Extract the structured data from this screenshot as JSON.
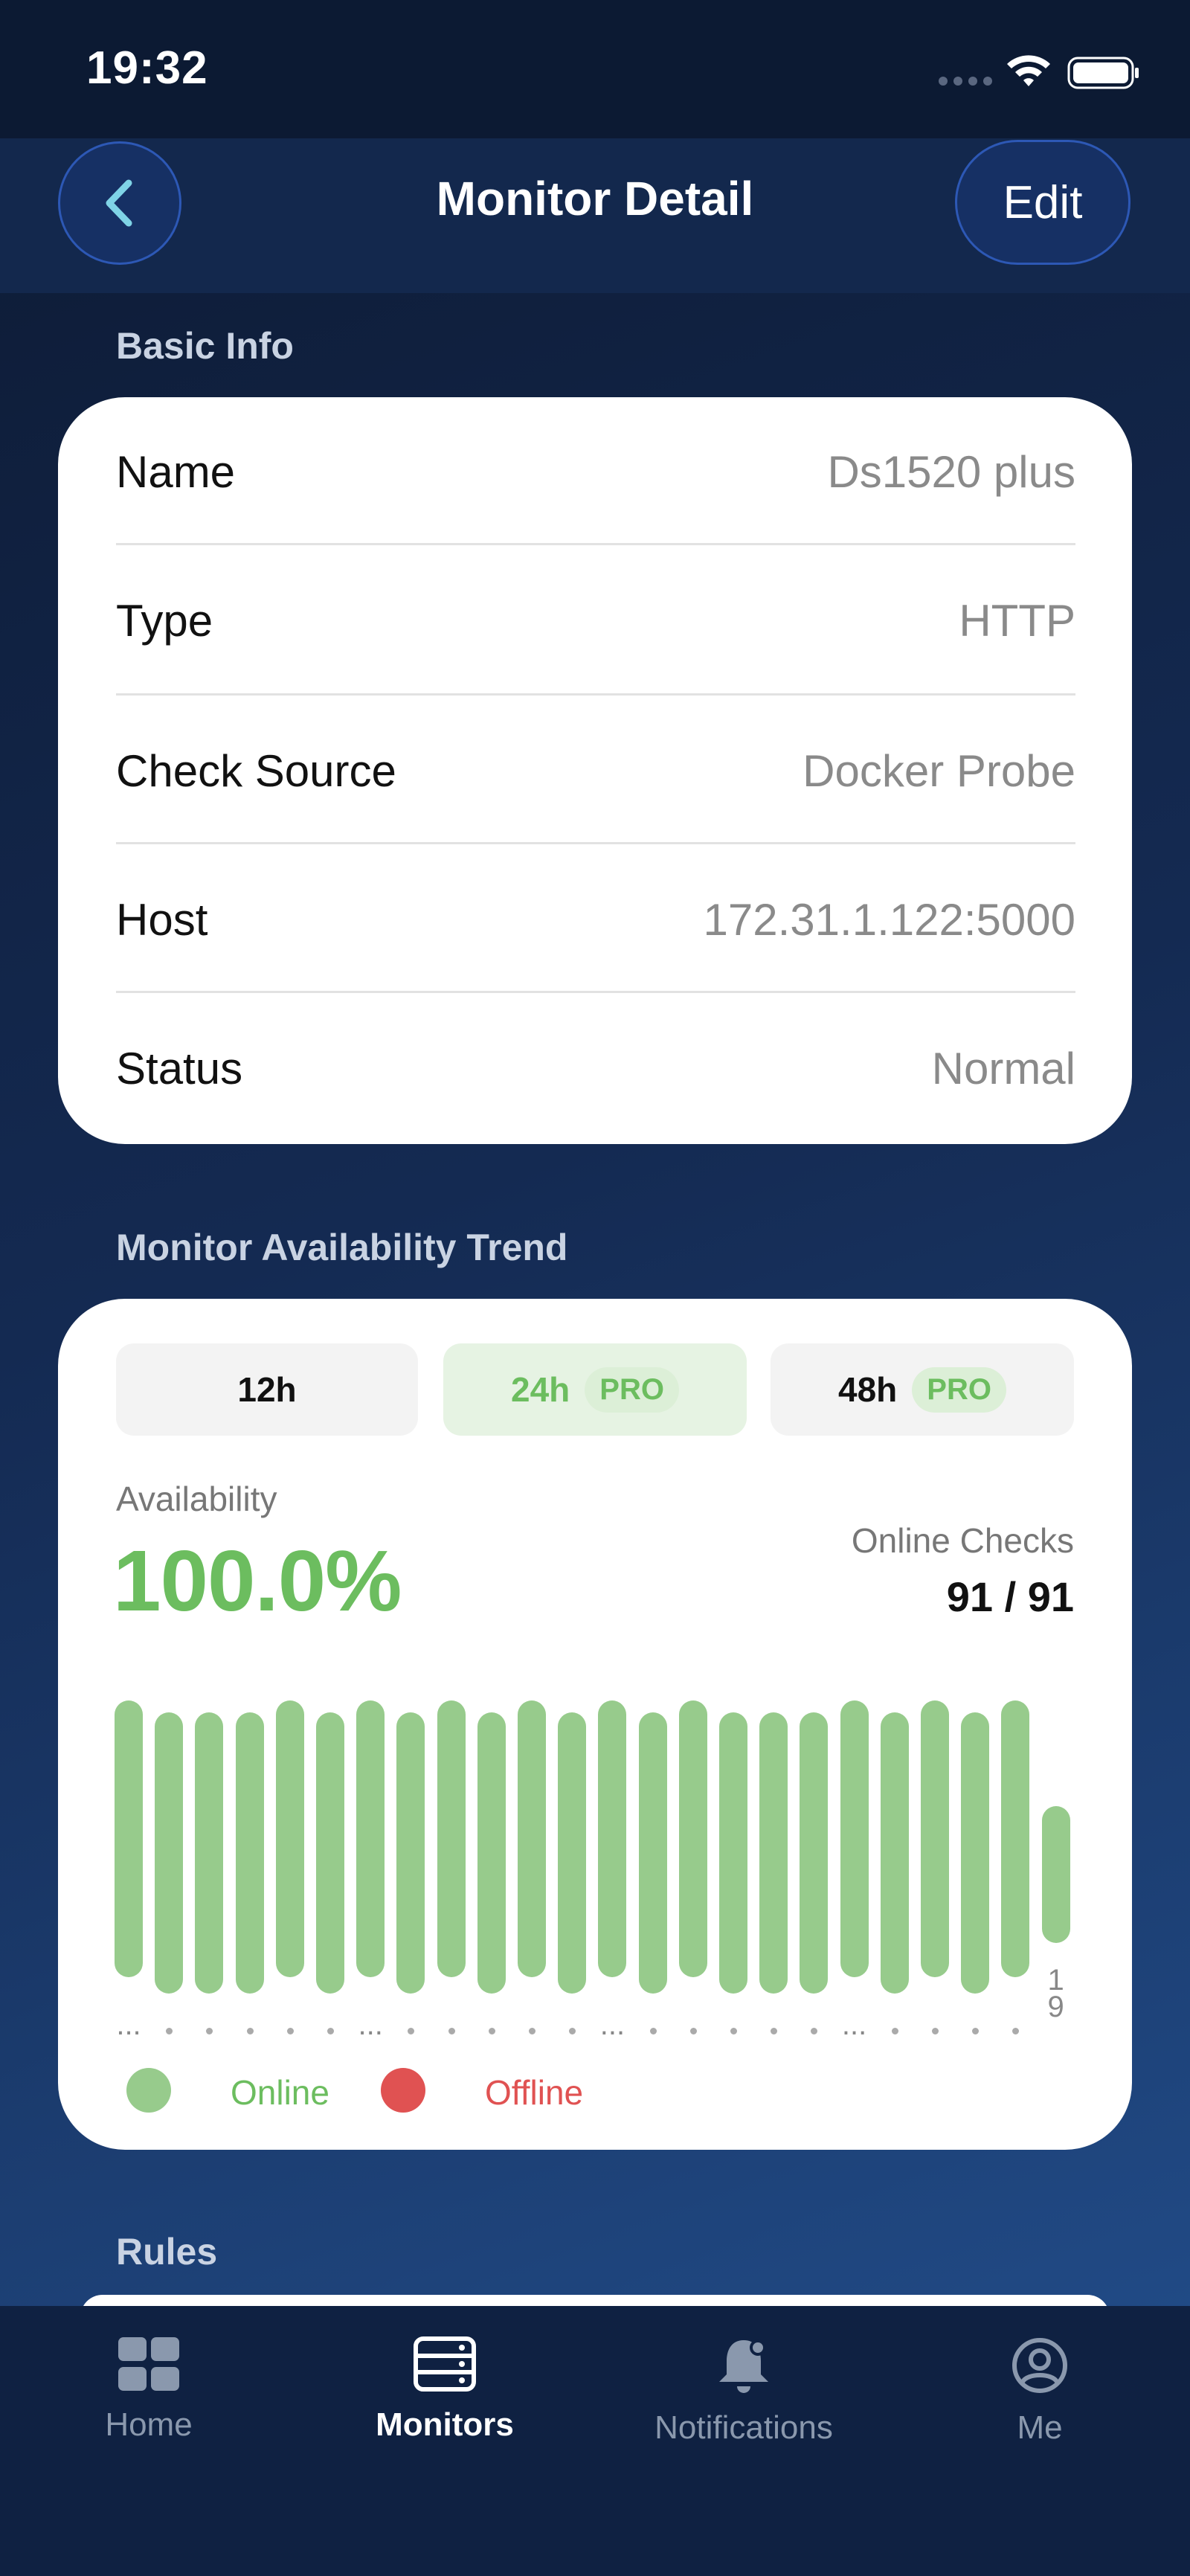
{
  "status_bar": {
    "time": "19:32"
  },
  "nav": {
    "title": "Monitor Detail",
    "edit_label": "Edit"
  },
  "basic_info": {
    "section_title": "Basic Info",
    "rows": [
      {
        "label": "Name",
        "value": "Ds1520 plus"
      },
      {
        "label": "Type",
        "value": "HTTP"
      },
      {
        "label": "Check Source",
        "value": "Docker Probe"
      },
      {
        "label": "Host",
        "value": "172.31.1.122:5000"
      },
      {
        "label": "Status",
        "value": "Normal"
      }
    ]
  },
  "trend": {
    "section_title": "Monitor Availability Trend",
    "ranges": [
      {
        "label": "12h",
        "pro": "",
        "active": false
      },
      {
        "label": "24h",
        "pro": "PRO",
        "active": true
      },
      {
        "label": "48h",
        "pro": "PRO",
        "active": false
      }
    ],
    "availability_label": "Availability",
    "availability_value": "100.0%",
    "online_checks_label": "Online Checks",
    "online_checks_value": "91 / 91",
    "legend": {
      "online": "Online",
      "offline": "Offline"
    },
    "colors": {
      "online": "#97cb8c",
      "offline": "#e05252",
      "accent": "#6cbd5f"
    }
  },
  "chart_data": {
    "type": "bar",
    "values": [
      4,
      4,
      3,
      4,
      4,
      4,
      4,
      4,
      4,
      3,
      4,
      4,
      4,
      4,
      4,
      4,
      3,
      4,
      4,
      4,
      4,
      4,
      4,
      2
    ],
    "status": [
      "online",
      "online",
      "online",
      "online",
      "online",
      "online",
      "online",
      "online",
      "online",
      "online",
      "online",
      "online",
      "online",
      "online",
      "online",
      "online",
      "online",
      "online",
      "online",
      "online",
      "online",
      "online",
      "online",
      "online"
    ],
    "x_tick_labels": [
      "...",
      "",
      "",
      "",
      "",
      "",
      "...",
      "",
      "",
      "",
      "",
      "",
      "...",
      "",
      "",
      "",
      "",
      "",
      "...",
      "",
      "",
      "",
      "",
      "19"
    ]
  },
  "rules": {
    "section_title": "Rules"
  },
  "tabs": [
    {
      "label": "Home",
      "active": false
    },
    {
      "label": "Monitors",
      "active": true
    },
    {
      "label": "Notifications",
      "active": false
    },
    {
      "label": "Me",
      "active": false
    }
  ]
}
